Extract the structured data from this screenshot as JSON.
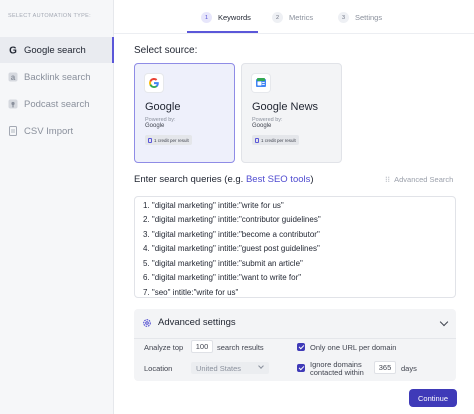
{
  "sidebar": {
    "heading": "SELECT AUTOMATION TYPE:",
    "items": [
      {
        "label": "Google search",
        "icon": "google-icon"
      },
      {
        "label": "Backlink search",
        "icon": "backlink-icon"
      },
      {
        "label": "Podcast search",
        "icon": "podcast-icon"
      },
      {
        "label": "CSV Import",
        "icon": "csv-icon"
      }
    ]
  },
  "steps": [
    {
      "num": "1",
      "label": "Keywords"
    },
    {
      "num": "2",
      "label": "Metrics"
    },
    {
      "num": "3",
      "label": "Settings"
    }
  ],
  "source": {
    "title": "Select source:",
    "cards": [
      {
        "title": "Google",
        "powered_label": "Powered by:",
        "powered_by": "Google",
        "credit": "1 credit per result",
        "icon": "google-logo-icon"
      },
      {
        "title": "Google News",
        "powered_label": "Powered by:",
        "powered_by": "Google",
        "credit": "1 credit per result",
        "icon": "google-news-logo-icon"
      }
    ]
  },
  "queries": {
    "title_prefix": "Enter search queries (e.g. ",
    "title_link": "Best SEO tools",
    "title_suffix": ")",
    "advanced_search": "Advanced Search",
    "lines": [
      "1.   \"digital marketing\" intitle:\"write for us\"",
      "2.   \"digital marketing\" intitle:\"contributor guidelines\"",
      "3.   \"digital marketing\" intitle:\"become a contributor\"",
      "4.   \"digital marketing\" intitle:\"guest post guidelines\"",
      "5.   \"digital marketing\" intitle:\"submit an article\"",
      "6.   \"digital marketing\" intitle:\"want to write for\"",
      "7.   \"seo\" intitle:\"write for us\""
    ]
  },
  "advanced": {
    "title": "Advanced settings",
    "analyze_label": "Analyze top",
    "analyze_value": "100",
    "analyze_suffix": "search results",
    "location_label": "Location",
    "location_value": "United States",
    "one_url_label": "Only one URL per domain",
    "one_url_checked": true,
    "ignore_label_1": "Ignore domains",
    "ignore_label_2": "contacted within",
    "ignore_value": "365",
    "ignore_suffix": "days",
    "ignore_checked": true
  },
  "continue_label": "Continue",
  "colors": {
    "accent": "#3f3ab8",
    "link": "#4f4bd0",
    "sidebar_bg": "#f6f7f9"
  }
}
